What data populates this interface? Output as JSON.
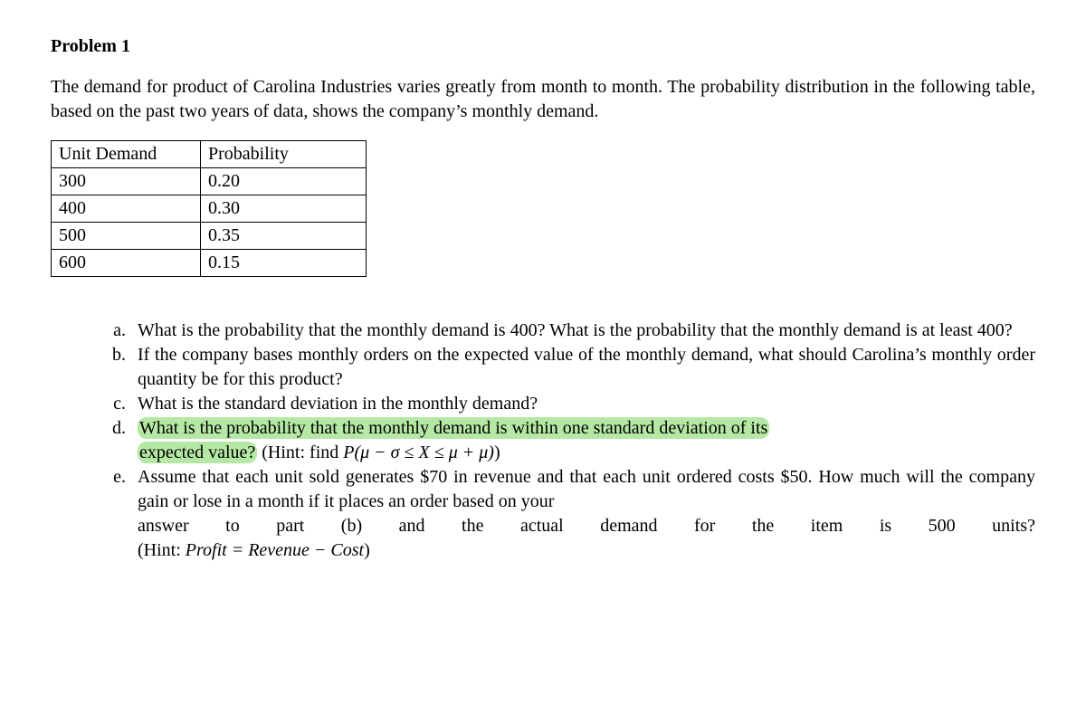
{
  "title": "Problem 1",
  "intro": "The demand for product of Carolina Industries varies greatly from month to month. The probability distribution in the following table, based on the past two years of data, shows the company’s monthly demand.",
  "table": {
    "header": {
      "col1": "Unit Demand",
      "col2": "Probability"
    },
    "rows": [
      {
        "demand": "300",
        "prob": "0.20"
      },
      {
        "demand": "400",
        "prob": "0.30"
      },
      {
        "demand": "500",
        "prob": "0.35"
      },
      {
        "demand": "600",
        "prob": "0.15"
      }
    ]
  },
  "q": {
    "a": "What is the probability that the monthly demand is 400? What is the probability that the monthly demand is at least 400?",
    "b": "If the company bases monthly orders on the expected value of the monthly demand, what should Carolina’s monthly order quantity be for this product?",
    "c": "What is the standard deviation in the monthly demand?",
    "d_part1": "What is the probability that the monthly demand is within one standard deviation of its",
    "d_part2": "expected value?",
    "d_hint_label": " (Hint: find ",
    "d_hint_math": "P(μ − σ ≤ X ≤ μ + μ)",
    "d_hint_close": ")",
    "e_line1": "Assume that each unit sold generates $70 in revenue and that each unit ordered costs $50. How much will the company gain or lose in a month if it places an order based on your",
    "e_w1": "answer",
    "e_w2": "to",
    "e_w3": "part",
    "e_w4": "(b)",
    "e_w5": "and",
    "e_w6": "the",
    "e_w7": "actual",
    "e_w8": "demand",
    "e_w9": "for",
    "e_w10": "the",
    "e_w11": "item",
    "e_w12": "is",
    "e_w13": "500",
    "e_w14": "units?",
    "e_hint_open": "(Hint: ",
    "e_hint_math": "Profit = Revenue − Cost",
    "e_hint_close": ")"
  },
  "chart_data": {
    "type": "table",
    "title": "Monthly Demand Probability Distribution",
    "columns": [
      "Unit Demand",
      "Probability"
    ],
    "rows": [
      [
        300,
        0.2
      ],
      [
        400,
        0.3
      ],
      [
        500,
        0.35
      ],
      [
        600,
        0.15
      ]
    ]
  }
}
